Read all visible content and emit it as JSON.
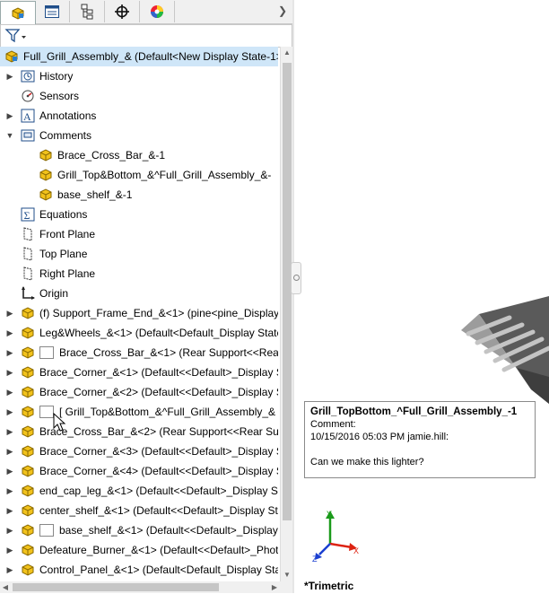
{
  "tabs": [
    {
      "name": "feature-manager-tab",
      "icon": "assembly-icon"
    },
    {
      "name": "property-manager-tab",
      "icon": "list-icon"
    },
    {
      "name": "configuration-manager-tab",
      "icon": "config-icon"
    },
    {
      "name": "dimxpert-tab",
      "icon": "crosshair-icon"
    },
    {
      "name": "display-manager-tab",
      "icon": "color-wheel-icon"
    }
  ],
  "tree": {
    "root": "Full_Grill_Assembly_&  (Default<New Display State-1>",
    "items": [
      {
        "label": "History",
        "icon": "history",
        "level": 1,
        "exp": "▶"
      },
      {
        "label": "Sensors",
        "icon": "sensor",
        "level": 1,
        "exp": ""
      },
      {
        "label": "Annotations",
        "icon": "annotation",
        "level": 1,
        "exp": "▶"
      },
      {
        "label": "Comments",
        "icon": "comment-folder",
        "level": 1,
        "exp": "▼"
      },
      {
        "label": "Brace_Cross_Bar_&-1",
        "icon": "part",
        "level": 2,
        "exp": ""
      },
      {
        "label": "Grill_Top&Bottom_&^Full_Grill_Assembly_&-",
        "icon": "part",
        "level": 2,
        "exp": ""
      },
      {
        "label": "base_shelf_&-1",
        "icon": "part",
        "level": 2,
        "exp": ""
      },
      {
        "label": "Equations",
        "icon": "equation",
        "level": 1,
        "exp": ""
      },
      {
        "label": "Front Plane",
        "icon": "plane",
        "level": 1,
        "exp": ""
      },
      {
        "label": "Top Plane",
        "icon": "plane",
        "level": 1,
        "exp": ""
      },
      {
        "label": "Right Plane",
        "icon": "plane",
        "level": 1,
        "exp": ""
      },
      {
        "label": "Origin",
        "icon": "origin",
        "level": 1,
        "exp": ""
      },
      {
        "label": "(f) Support_Frame_End_&<1> (pine<pine_Display",
        "icon": "part",
        "level": 1,
        "exp": "▶"
      },
      {
        "label": "Leg&Wheels_&<1> (Default<Default_Display State",
        "icon": "part",
        "level": 1,
        "exp": "▶"
      },
      {
        "label": "Brace_Cross_Bar_&<1> (Rear Support<<Rear",
        "icon": "part",
        "level": 1,
        "exp": "▶",
        "box": true
      },
      {
        "label": "Brace_Corner_&<1> (Default<<Default>_Display S",
        "icon": "part",
        "level": 1,
        "exp": "▶"
      },
      {
        "label": "Brace_Corner_&<2> (Default<<Default>_Display S",
        "icon": "part",
        "level": 1,
        "exp": "▶"
      },
      {
        "label": "[ Grill_Top&Bottom_&^Full_Grill_Assembly_&",
        "icon": "part",
        "level": 1,
        "exp": "▶",
        "box": true,
        "hover": true
      },
      {
        "label": "Brace_Cross_Bar_&<2> (Rear Support<<Rear Supp",
        "icon": "part",
        "level": 1,
        "exp": "▶"
      },
      {
        "label": "Brace_Corner_&<3> (Default<<Default>_Display S",
        "icon": "part",
        "level": 1,
        "exp": "▶"
      },
      {
        "label": "Brace_Corner_&<4> (Default<<Default>_Display S",
        "icon": "part",
        "level": 1,
        "exp": "▶"
      },
      {
        "label": "end_cap_leg_&<1> (Default<<Default>_Display St",
        "icon": "part",
        "level": 1,
        "exp": "▶"
      },
      {
        "label": "center_shelf_&<1> (Default<<Default>_Display St",
        "icon": "part",
        "level": 1,
        "exp": "▶"
      },
      {
        "label": "base_shelf_&<1> (Default<<Default>_Display",
        "icon": "part",
        "level": 1,
        "exp": "▶",
        "box": true
      },
      {
        "label": "Defeature_Burner_&<1> (Default<<Default>_Phot",
        "icon": "part",
        "level": 1,
        "exp": "▶"
      },
      {
        "label": "Control_Panel_&<1> (Default<Default_Display Sta",
        "icon": "part",
        "level": 1,
        "exp": "▶"
      }
    ]
  },
  "tooltip": {
    "title": "Grill_TopBottom_^Full_Grill_Assembly_-1",
    "label": "Comment:",
    "meta": "10/15/2016 05:03 PM  jamie.hill:",
    "body": "Can we make this lighter?"
  },
  "view": {
    "orientation": "*Trimetric"
  },
  "colors": {
    "selection": "#cfe6f8",
    "part_yellow": "#f2c21b",
    "part_blue": "#2a7fd0"
  }
}
